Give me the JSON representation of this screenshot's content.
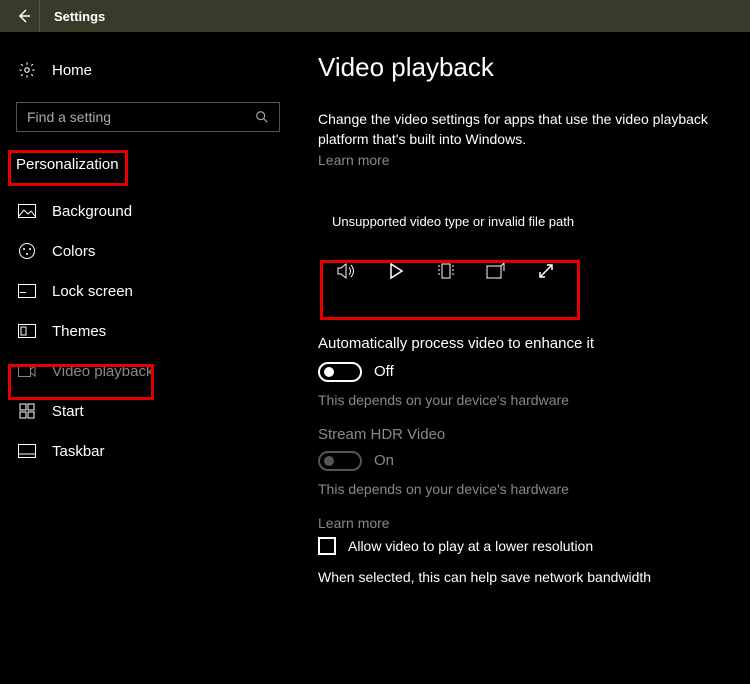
{
  "titlebar": {
    "app_title": "Settings"
  },
  "sidebar": {
    "home_label": "Home",
    "search_placeholder": "Find a setting",
    "section_title": "Personalization",
    "items": [
      {
        "label": "Background"
      },
      {
        "label": "Colors"
      },
      {
        "label": "Lock screen"
      },
      {
        "label": "Themes"
      },
      {
        "label": "Video playback"
      },
      {
        "label": "Start"
      },
      {
        "label": "Taskbar"
      }
    ]
  },
  "main": {
    "page_title": "Video playback",
    "description": "Change the video settings for apps that use the video playback platform that's built into Windows.",
    "learn_more": "Learn more",
    "video_error": "Unsupported video type or invalid file path",
    "auto_process": {
      "heading": "Automatically process video to enhance it",
      "toggle_state": "Off",
      "hint": "This depends on your device's hardware"
    },
    "stream_hdr": {
      "heading": "Stream HDR Video",
      "toggle_state": "On",
      "hint": "This depends on your device's hardware",
      "learn_more": "Learn more"
    },
    "lower_res": {
      "label": "Allow video to play at a lower resolution",
      "hint": "When selected, this can help save network bandwidth"
    }
  }
}
